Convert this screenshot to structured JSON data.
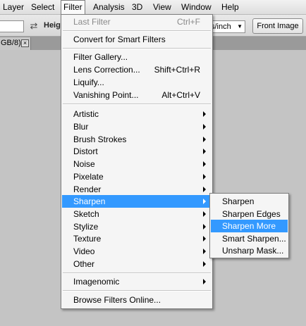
{
  "menubar": {
    "items": [
      "Layer",
      "Select",
      "Filter",
      "Analysis",
      "3D",
      "View",
      "Window",
      "Help"
    ],
    "active": "Filter"
  },
  "options_bar": {
    "height_label": "Heigh",
    "resolution_unit": "s/inch",
    "front_image_button": "Front Image"
  },
  "doc_tab": {
    "label": "GB/8)",
    "close": "×"
  },
  "filter_menu": {
    "last_filter": {
      "label": "Last Filter",
      "shortcut": "Ctrl+F",
      "disabled": true
    },
    "convert": "Convert for Smart Filters",
    "gallery_group": [
      {
        "label": "Filter Gallery...",
        "shortcut": ""
      },
      {
        "label": "Lens Correction...",
        "shortcut": "Shift+Ctrl+R"
      },
      {
        "label": "Liquify...",
        "shortcut": ""
      },
      {
        "label": "Vanishing Point...",
        "shortcut": "Alt+Ctrl+V"
      }
    ],
    "submenus": [
      "Artistic",
      "Blur",
      "Brush Strokes",
      "Distort",
      "Noise",
      "Pixelate",
      "Render",
      "Sharpen",
      "Sketch",
      "Stylize",
      "Texture",
      "Video",
      "Other"
    ],
    "highlighted": "Sharpen",
    "plugin": "Imagenomic",
    "browse": "Browse Filters Online..."
  },
  "sharpen_submenu": {
    "items": [
      "Sharpen",
      "Sharpen Edges",
      "Sharpen More",
      "Smart Sharpen...",
      "Unsharp Mask..."
    ],
    "highlighted": "Sharpen More"
  },
  "colors": {
    "highlight": "#3399ff",
    "menu_bg": "#f5f5f5",
    "disabled_text": "#8a8a8a"
  }
}
